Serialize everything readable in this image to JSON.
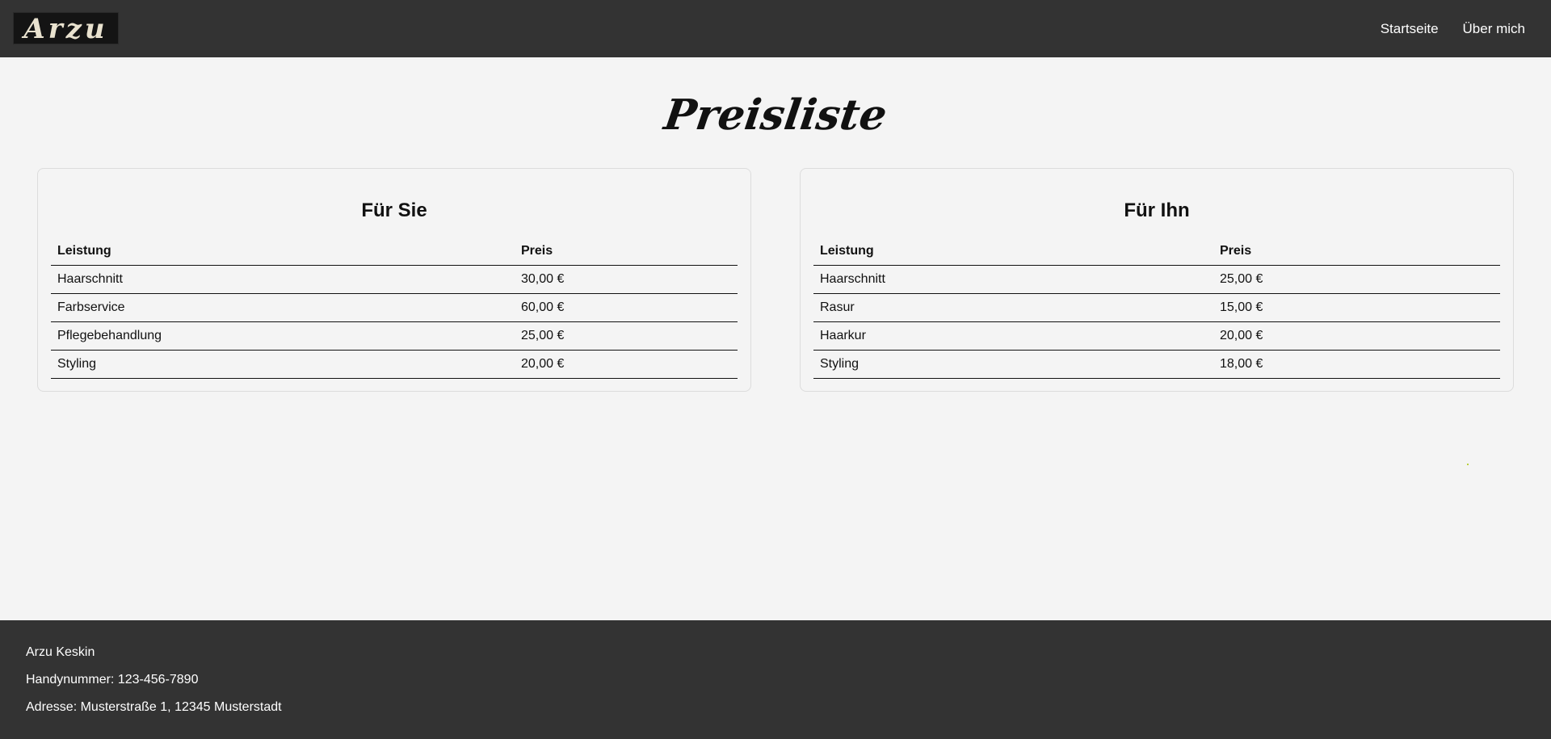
{
  "header": {
    "logo_text": "Arzu",
    "nav": [
      {
        "label": "Startseite"
      },
      {
        "label": "Über mich"
      }
    ]
  },
  "main": {
    "title": "Preisliste",
    "cards": [
      {
        "title": "Für Sie",
        "columns": [
          "Leistung",
          "Preis"
        ],
        "rows": [
          {
            "service": "Haarschnitt",
            "price": "30,00 €"
          },
          {
            "service": "Farbservice",
            "price": "60,00 €"
          },
          {
            "service": "Pflegebehandlung",
            "price": "25,00 €"
          },
          {
            "service": "Styling",
            "price": "20,00 €"
          }
        ]
      },
      {
        "title": "Für Ihn",
        "columns": [
          "Leistung",
          "Preis"
        ],
        "rows": [
          {
            "service": "Haarschnitt",
            "price": "25,00 €"
          },
          {
            "service": "Rasur",
            "price": "15,00 €"
          },
          {
            "service": "Haarkur",
            "price": "20,00 €"
          },
          {
            "service": "Styling",
            "price": "18,00 €"
          }
        ]
      }
    ]
  },
  "footer": {
    "name": "Arzu Keskin",
    "phone": "Handynummer: 123-456-7890",
    "address": "Adresse: Musterstraße 1, 12345 Musterstadt"
  },
  "colors": {
    "header_bg": "#333333",
    "footer_bg": "#333333",
    "page_bg": "#f4f4f4"
  }
}
